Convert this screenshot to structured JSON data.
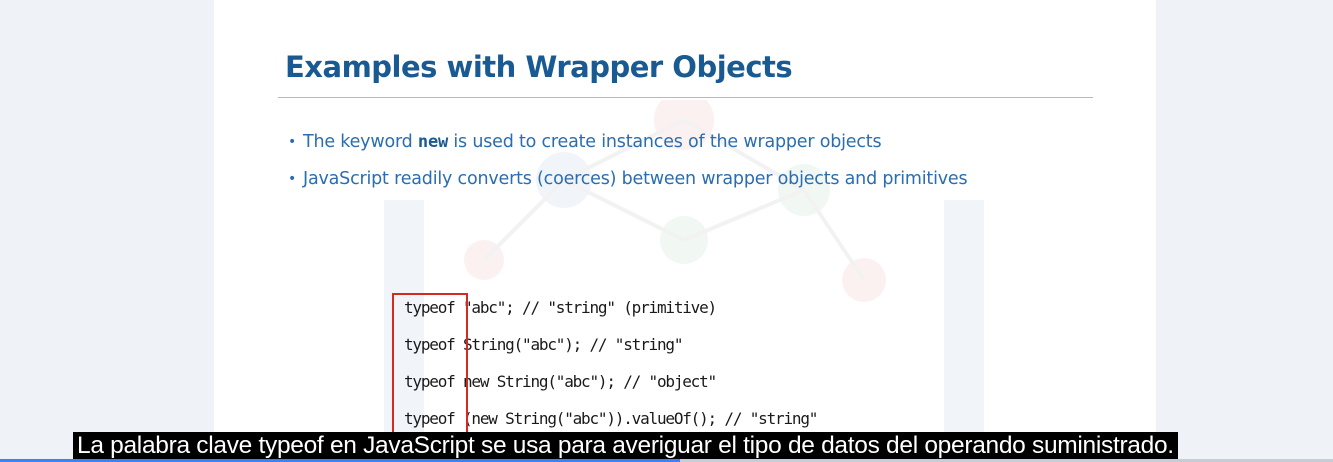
{
  "slide": {
    "title": "Examples with Wrapper Objects",
    "bullets": [
      {
        "before": "The keyword ",
        "keyword": "new",
        "after": " is used to create instances of the wrapper objects"
      },
      {
        "text": "JavaScript readily converts (coerces) between wrapper objects and primitives"
      }
    ],
    "bullet_marker": "•",
    "code_lines": [
      {
        "keyword": "typeof",
        "rest": "\"abc\"; // \"string\" (primitive)"
      },
      {
        "keyword": "typeof",
        "rest": "String(\"abc\"); // \"string\""
      },
      {
        "keyword": "typeof",
        "rest": "new String(\"abc\"); // \"object\""
      },
      {
        "keyword": "typeof",
        "rest": "(new String(\"abc\")).valueOf(); // \"string\""
      }
    ]
  },
  "subtitle": "La palabra clave typeof en JavaScript se usa para averiguar el tipo de datos del operando suministrado.",
  "video": {
    "progress_fraction": 0.51
  },
  "colors": {
    "title": "#1a5a93",
    "bullet_text": "#2a6db0",
    "highlight_box": "#d32a22",
    "caption_bg": "#000000",
    "progress": "#3b82f6"
  }
}
